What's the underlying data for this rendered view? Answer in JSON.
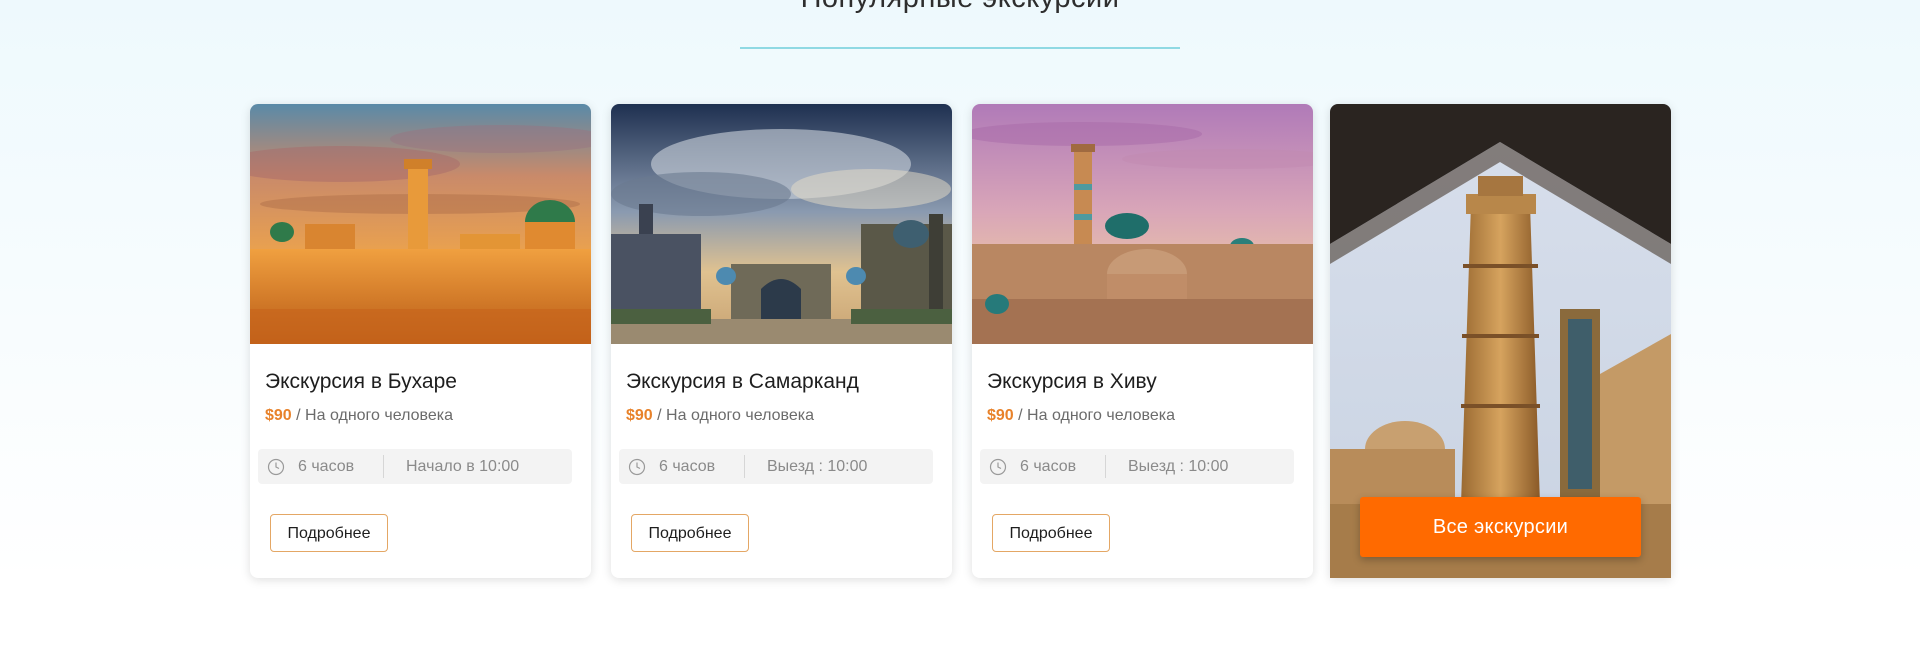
{
  "section": {
    "title": "Популярные экскурсии"
  },
  "tours": [
    {
      "title": "Экскурсия в Бухаре",
      "price": "$90",
      "price_suffix": " / На одного человека",
      "duration": "6 часов",
      "start": "Начало в 10:00",
      "button": "Подробнее"
    },
    {
      "title": "Экскурсия в Самарканд",
      "price": "$90",
      "price_suffix": " / На одного человека",
      "duration": "6 часов",
      "start": "Выезд : 10:00",
      "button": "Подробнее"
    },
    {
      "title": "Экскурсия в Хиву",
      "price": "$90",
      "price_suffix": " / На одного человека",
      "duration": "6 часов",
      "start": "Выезд : 10:00",
      "button": "Подробнее"
    }
  ],
  "all_tours_button": "Все экскурсии",
  "icons": {
    "duration": "clock-icon"
  },
  "colors": {
    "accent": "#ff6a00",
    "price": "#e8822a",
    "underline": "#8fd9e3",
    "button_border": "#e4a765"
  }
}
